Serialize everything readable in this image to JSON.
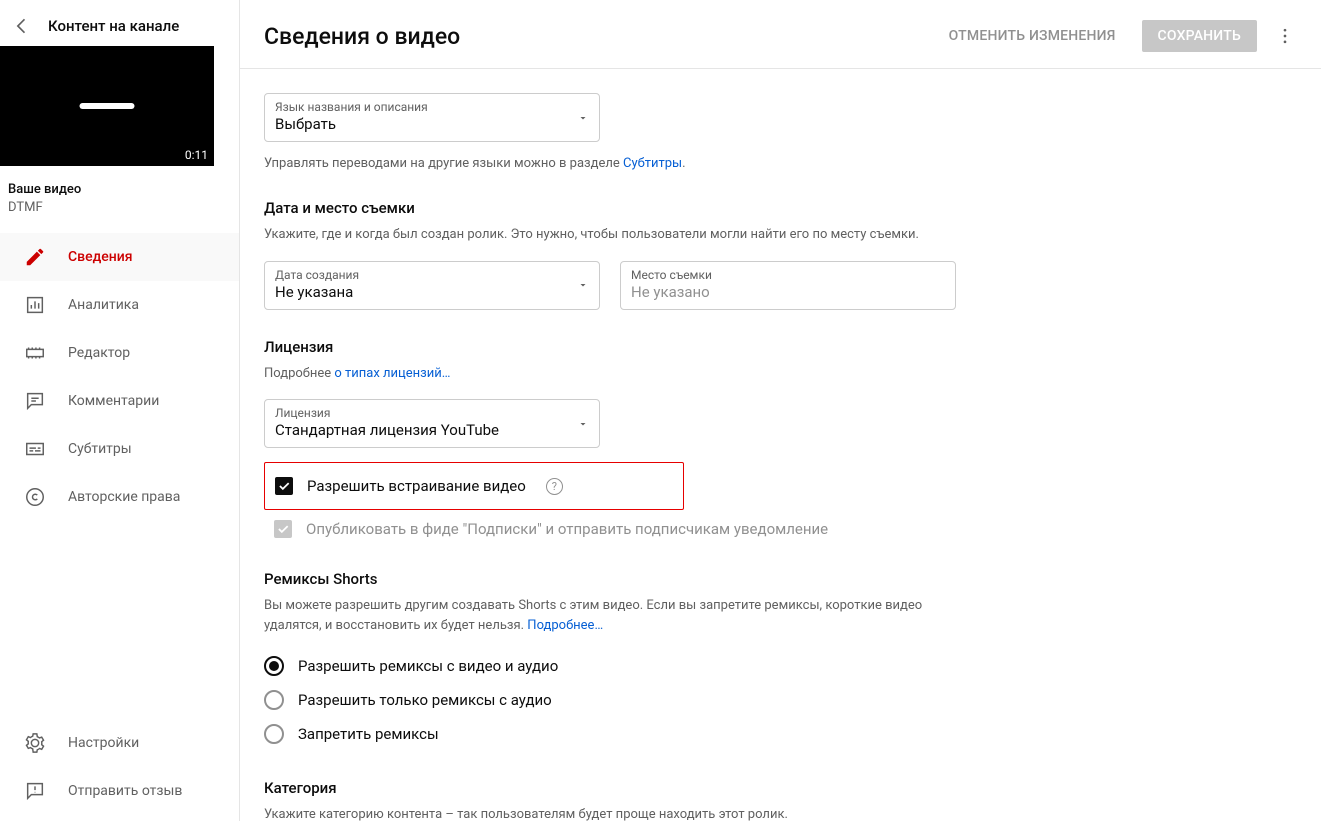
{
  "sidebar": {
    "header": "Контент на канале",
    "video_label": "Ваше видео",
    "video_title": "DTMF",
    "video_duration": "0:11",
    "nav": [
      {
        "label": "Сведения"
      },
      {
        "label": "Аналитика"
      },
      {
        "label": "Редактор"
      },
      {
        "label": "Комментарии"
      },
      {
        "label": "Субтитры"
      },
      {
        "label": "Авторские права"
      }
    ],
    "footer": [
      {
        "label": "Настройки"
      },
      {
        "label": "Отправить отзыв"
      }
    ]
  },
  "header": {
    "title": "Сведения о видео",
    "cancel": "ОТМЕНИТЬ ИЗМЕНЕНИЯ",
    "save": "СОХРАНИТЬ"
  },
  "lang": {
    "label": "Язык названия и описания",
    "value": "Выбрать"
  },
  "subtitles_hint_prefix": "Управлять переводами на другие языки можно в разделе ",
  "subtitles_link": "Субтитры",
  "date_section": {
    "title": "Дата и место съемки",
    "desc": "Укажите, где и когда был создан ролик. Это нужно, чтобы пользователи могли найти его по месту съемки.",
    "date_label": "Дата создания",
    "date_value": "Не указана",
    "location_label": "Место съемки",
    "location_placeholder": "Не указано"
  },
  "license": {
    "title": "Лицензия",
    "desc_prefix": "Подробнее ",
    "desc_link": "о типах лицензий…",
    "label": "Лицензия",
    "value": "Стандартная лицензия YouTube",
    "allow_embed": "Разрешить встраивание видео",
    "publish_feed": "Опубликовать в фиде \"Подписки\" и отправить подписчикам уведомление"
  },
  "remix": {
    "title": "Ремиксы Shorts",
    "desc": "Вы можете разрешить другим создавать Shorts с этим видео. Если вы запретите ремиксы, короткие видео удалятся, и восстановить их будет нельзя. ",
    "learn_more": "Подробнее…",
    "options": [
      "Разрешить ремиксы с видео и аудио",
      "Разрешить только ремиксы с аудио",
      "Запретить ремиксы"
    ]
  },
  "category": {
    "title": "Категория",
    "desc": "Укажите категорию контента – так пользователям будет проще находить этот ролик."
  }
}
